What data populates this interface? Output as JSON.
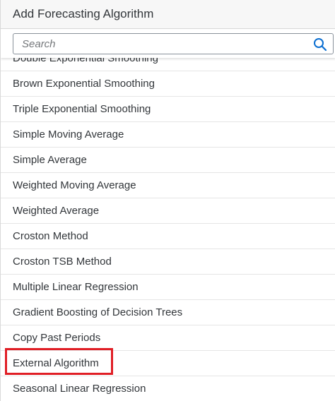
{
  "dialog": {
    "title": "Add Forecasting Algorithm"
  },
  "search": {
    "placeholder": "Search",
    "value": "",
    "icon": "search-icon"
  },
  "list": {
    "items": [
      {
        "label": "Double Exponential Smoothing"
      },
      {
        "label": "Brown Exponential Smoothing"
      },
      {
        "label": "Triple Exponential Smoothing"
      },
      {
        "label": "Simple Moving Average"
      },
      {
        "label": "Simple Average"
      },
      {
        "label": "Weighted Moving Average"
      },
      {
        "label": "Weighted Average"
      },
      {
        "label": "Croston Method"
      },
      {
        "label": "Croston TSB Method"
      },
      {
        "label": "Multiple Linear Regression"
      },
      {
        "label": "Gradient Boosting of Decision Trees"
      },
      {
        "label": "Copy Past Periods"
      },
      {
        "label": "External Algorithm",
        "highlighted": true
      },
      {
        "label": "Seasonal Linear Regression"
      }
    ]
  },
  "colors": {
    "accent": "#0a6ed1",
    "highlight": "#e01e25",
    "text": "#32363a"
  }
}
